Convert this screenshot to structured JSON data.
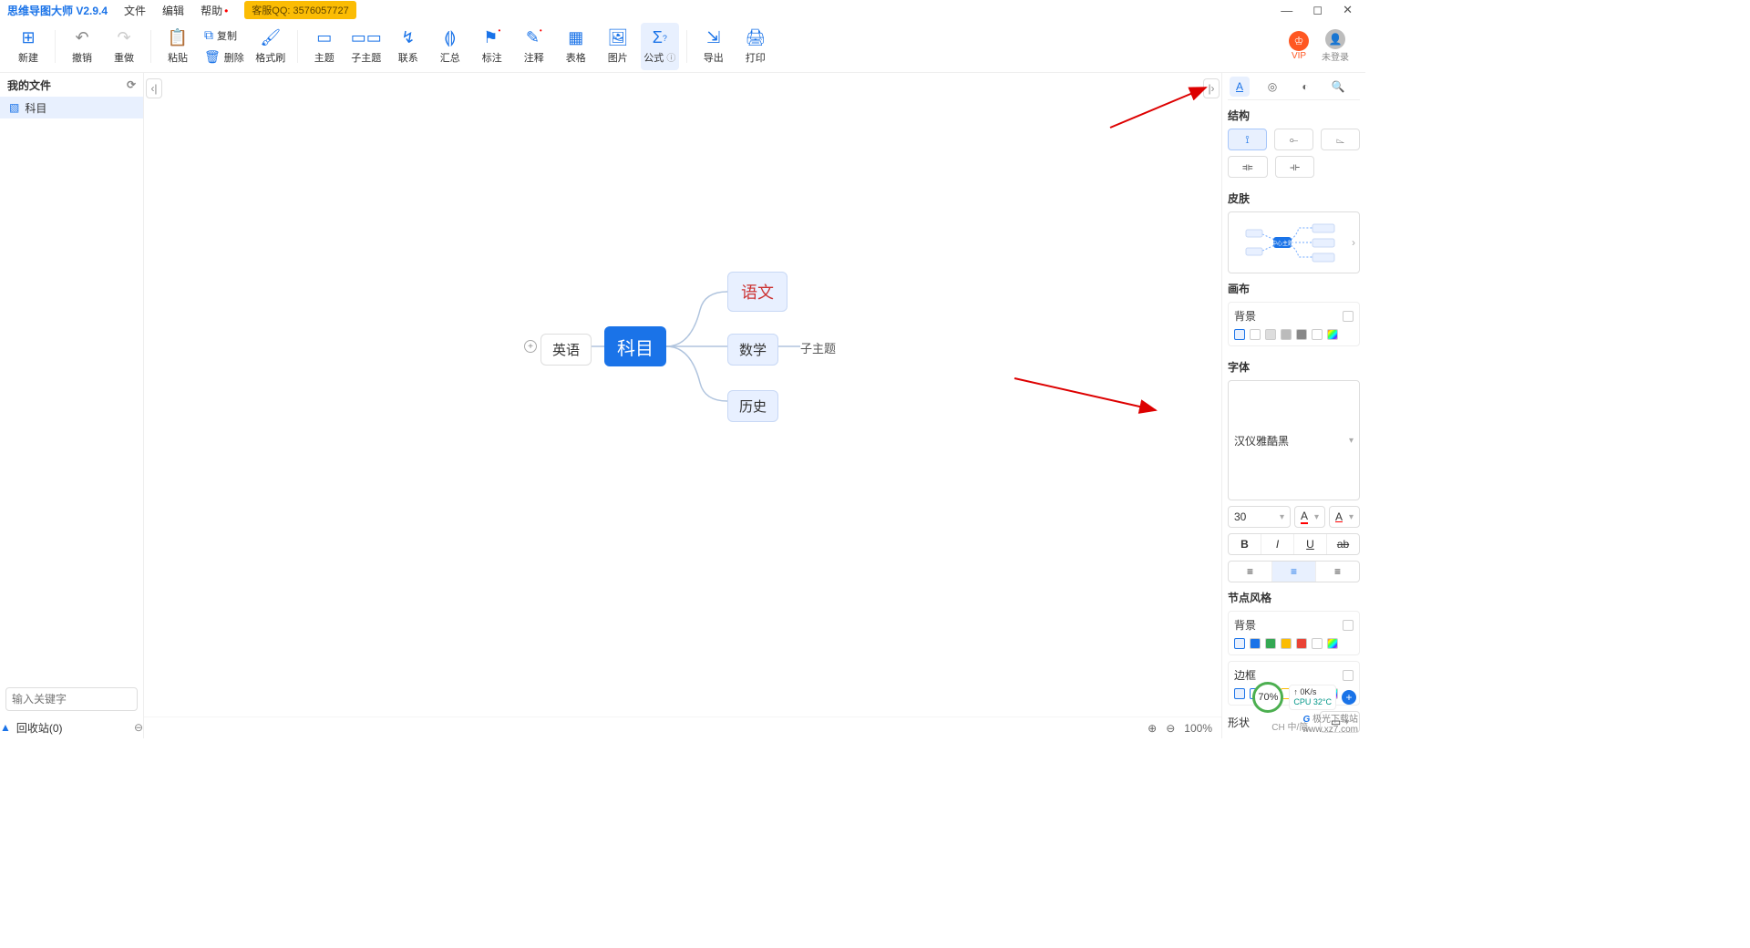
{
  "app": {
    "title": "思维导图大师 V2.9.4"
  },
  "menu": {
    "file": "文件",
    "edit": "编辑",
    "help": "帮助",
    "qq": "客服QQ: 3576057727"
  },
  "win": {
    "min": "—",
    "max": "◻",
    "close": "✕"
  },
  "toolbar": {
    "new": "新建",
    "undo": "撤销",
    "redo": "重做",
    "paste": "粘贴",
    "copy": "复制",
    "delete": "删除",
    "format": "格式刷",
    "topic": "主题",
    "subtopic": "子主题",
    "relation": "联系",
    "summary": "汇总",
    "mark": "标注",
    "note": "注释",
    "table": "表格",
    "image": "图片",
    "formula": "公式",
    "export": "导出",
    "print": "打印",
    "vip": "VIP",
    "login": "未登录"
  },
  "sidebar": {
    "header": "我的文件",
    "file": "科目",
    "search_placeholder": "输入关键字",
    "recycle": "回收站(0)"
  },
  "mindmap": {
    "center": "科目",
    "n1": "语文",
    "n2": "数学",
    "n3": "历史",
    "left": "英语",
    "leaf": "子主题"
  },
  "panel": {
    "structure": "结构",
    "skin": "皮肤",
    "canvas": "画布",
    "bg": "背景",
    "font": "字体",
    "font_name": "汉仪雅酷黑",
    "font_size": "30",
    "node_style": "节点风格",
    "border": "边框",
    "shape": "形状"
  },
  "status": {
    "zoom": "100%"
  },
  "perf": {
    "pct": "70%",
    "net": "0K/s",
    "cpu": "CPU 32°C"
  },
  "watermark": {
    "l1": "极光下载站",
    "l2": "www.xz7.com"
  },
  "ime": "CH 中/简,"
}
